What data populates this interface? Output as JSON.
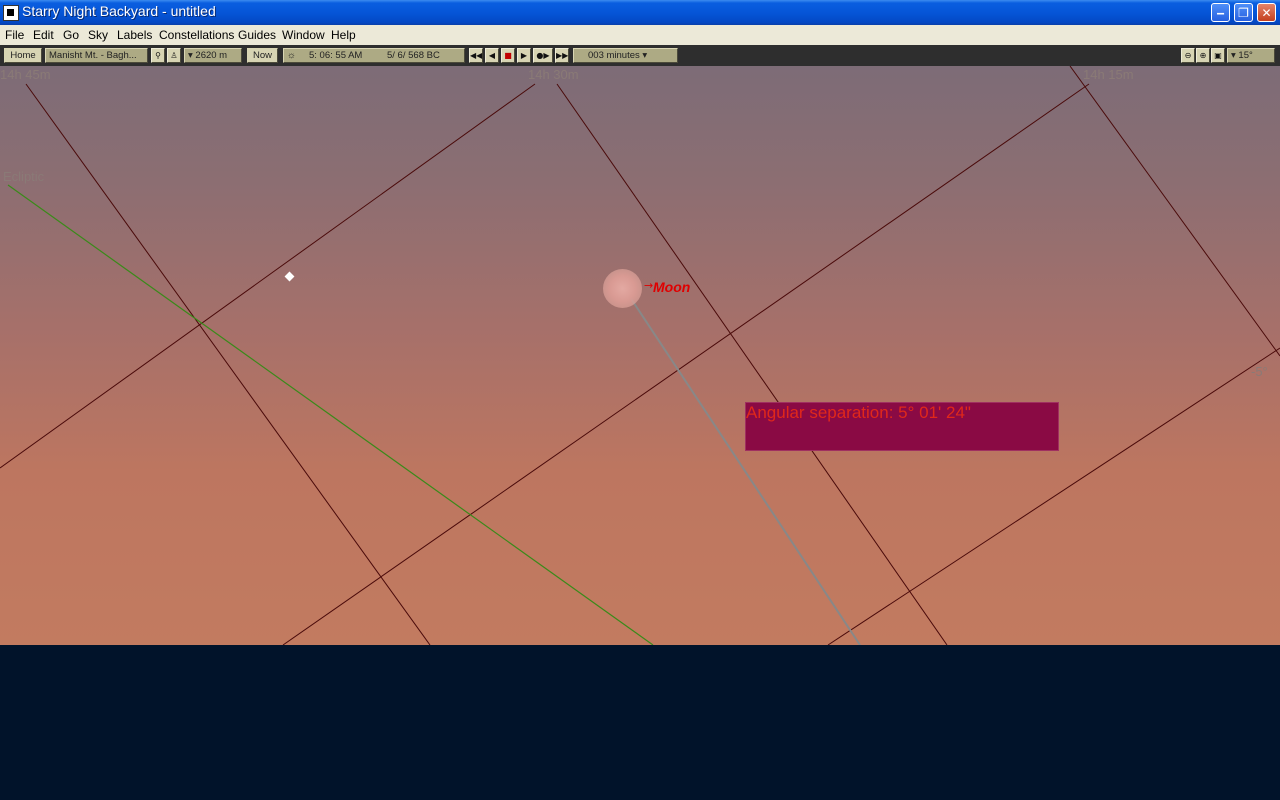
{
  "window": {
    "title": "Starry Night Backyard - untitled",
    "minimize": "‒",
    "restore": "❐",
    "close": "✕"
  },
  "menu": [
    "File",
    "Edit",
    "Go",
    "Sky",
    "Labels",
    "Constellations",
    "Guides",
    "Window",
    "Help"
  ],
  "toolbar": {
    "home": "Home",
    "location": "Manisht Mt. - Bagh...",
    "elevation": "▾ 2620 m",
    "now": "Now",
    "time": "5: 06: 55 AM",
    "date": "5/   6/   568 BC",
    "step": "003 minutes ▾",
    "fov": "▾ 15°"
  },
  "sky": {
    "ra_labels": [
      "14h 45m",
      "14h 30m",
      "14h 15m"
    ],
    "ecliptic_label": "Ecliptic",
    "dec_label": "-5°",
    "moon_label": "Moon",
    "separation": "Angular separation: 5° 01' 24\""
  },
  "colors": {
    "grid_line": "#4a0a0a",
    "ecliptic": "#3a8a1a",
    "measure_line": "#888888",
    "label_red": "#e00000"
  }
}
